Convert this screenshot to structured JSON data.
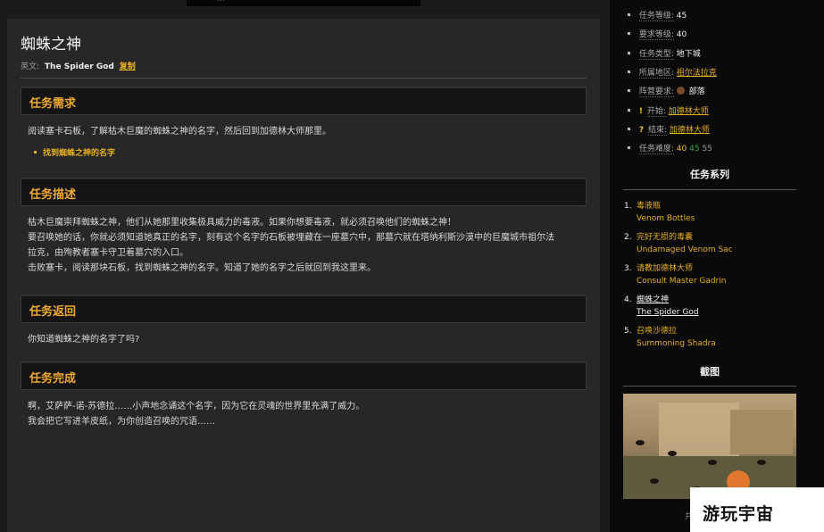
{
  "top_strip": {
    "text": "..."
  },
  "quest": {
    "title": "蜘蛛之神",
    "english_label": "英文:",
    "english_name": "The Spider God",
    "copy_label": "复制"
  },
  "sections": {
    "requirement": {
      "heading": "任务需求",
      "text": "阅读塞卡石板，了解枯木巨魔的蜘蛛之神的名字，然后回到加德林大师那里。",
      "objective": "找到蜘蛛之神的名字"
    },
    "description": {
      "heading": "任务描述",
      "lines": [
        "枯木巨魔崇拜蜘蛛之神，他们从她那里收集极具威力的毒液。如果你想要毒液，就必须召唤他们的蜘蛛之神！",
        "要召唤她的话，你就必须知道她真正的名字，刻有这个名字的石板被埋藏在一座墓穴中，那墓穴就在塔纳利斯沙漠中的巨魔城市祖尔法",
        "拉克，由殉教者塞卡守卫着墓穴的入口。",
        "击败塞卡，阅读那块石板，找到蜘蛛之神的名字。知道了她的名字之后就回到我这里来。"
      ]
    },
    "return": {
      "heading": "任务返回",
      "text": "你知道蜘蛛之神的名字了吗?"
    },
    "complete": {
      "heading": "任务完成",
      "lines": [
        "啊，艾萨萨-诺-苏德拉……小声地念诵这个名字，因为它在灵魂的世界里充满了威力。",
        "我会把它写进羊皮纸，为你创造召唤的咒语……"
      ]
    }
  },
  "sidebar": {
    "info": {
      "quest_level_label": "任务等级:",
      "quest_level": "45",
      "req_level_label": "要求等级:",
      "req_level": "40",
      "type_label": "任务类型:",
      "type": "地下城",
      "zone_label": "所属地区:",
      "zone": "祖尔法拉克",
      "faction_label": "阵营要求:",
      "faction": "部落",
      "start_label": "开始:",
      "start": "加德林大师",
      "end_label": "结束:",
      "end": "加德林大师",
      "difficulty_label": "任务难度:",
      "difficulty": [
        "40",
        "45",
        "55"
      ]
    },
    "series_heading": "任务系列",
    "series": [
      {
        "num": "1.",
        "cn": "毒液瓶",
        "en": "Venom Bottles"
      },
      {
        "num": "2.",
        "cn": "完好无损的毒囊",
        "en": "Undamaged Venom Sac"
      },
      {
        "num": "3.",
        "cn": "请教加德林大师",
        "en": "Consult Master Gadrin"
      },
      {
        "num": "4.",
        "cn": "蜘蛛之神",
        "en": "The Spider God"
      },
      {
        "num": "5.",
        "cn": "召唤沙德拉",
        "en": "Summoning Shadra"
      }
    ],
    "screenshot_heading": "截图",
    "caption": "共"
  },
  "watermark": {
    "text": "游玩宇宙"
  },
  "colors": {
    "accent": "#f0a830",
    "link": "#e6b020",
    "background": "#1b1b1b",
    "panel": "#272727"
  }
}
